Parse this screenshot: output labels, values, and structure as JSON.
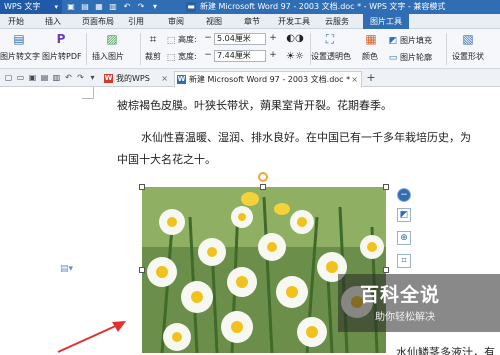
{
  "titlebar": {
    "app_name": "WPS 文字",
    "doc_title": "新建 Microsoft Word 97 - 2003 文档.doc * - WPS 文字 - 兼容模式"
  },
  "menu": {
    "tabs": [
      "开始",
      "插入",
      "页面布局",
      "引用",
      "审阅",
      "视图",
      "章节",
      "开发工具",
      "云服务",
      "图片工具"
    ],
    "active": "图片工具"
  },
  "ribbon": {
    "img_to_text": "图片转文字",
    "img_to_pdf": "图片转PDF",
    "insert_image": "插入图片",
    "crop": "裁剪",
    "height_label": "高度:",
    "height_value": "5.04厘米",
    "width_label": "宽度:",
    "width_value": "7.44厘米",
    "set_transparent": "设置透明色",
    "color": "颜色",
    "image_fill": "图片填充",
    "image_outline": "图片轮廓",
    "set_shape": "设置形状"
  },
  "tabs": {
    "wps_tab": "我的WPS",
    "doc_tab": "新建 Microsoft Word 97 - 2003 文档.doc *",
    "add_tab": "+"
  },
  "document": {
    "line1": "被棕褐色皮膜。叶狭长带状，蒴果室背开裂。花期春季。",
    "line2": "水仙性喜温暖、湿润、排水良好。在中国已有一千多年栽培历史，为",
    "line3": "中国十大名花之十。",
    "line4_tail": "水仙鳞茎多液汁，有"
  },
  "watermark": {
    "title": "百科全说",
    "subtitle": "助你轻松解决"
  },
  "colors": {
    "brand_blue": "#2f6db5",
    "annotation_red": "#e0322b",
    "rotate_handle": "#f2a33a"
  }
}
